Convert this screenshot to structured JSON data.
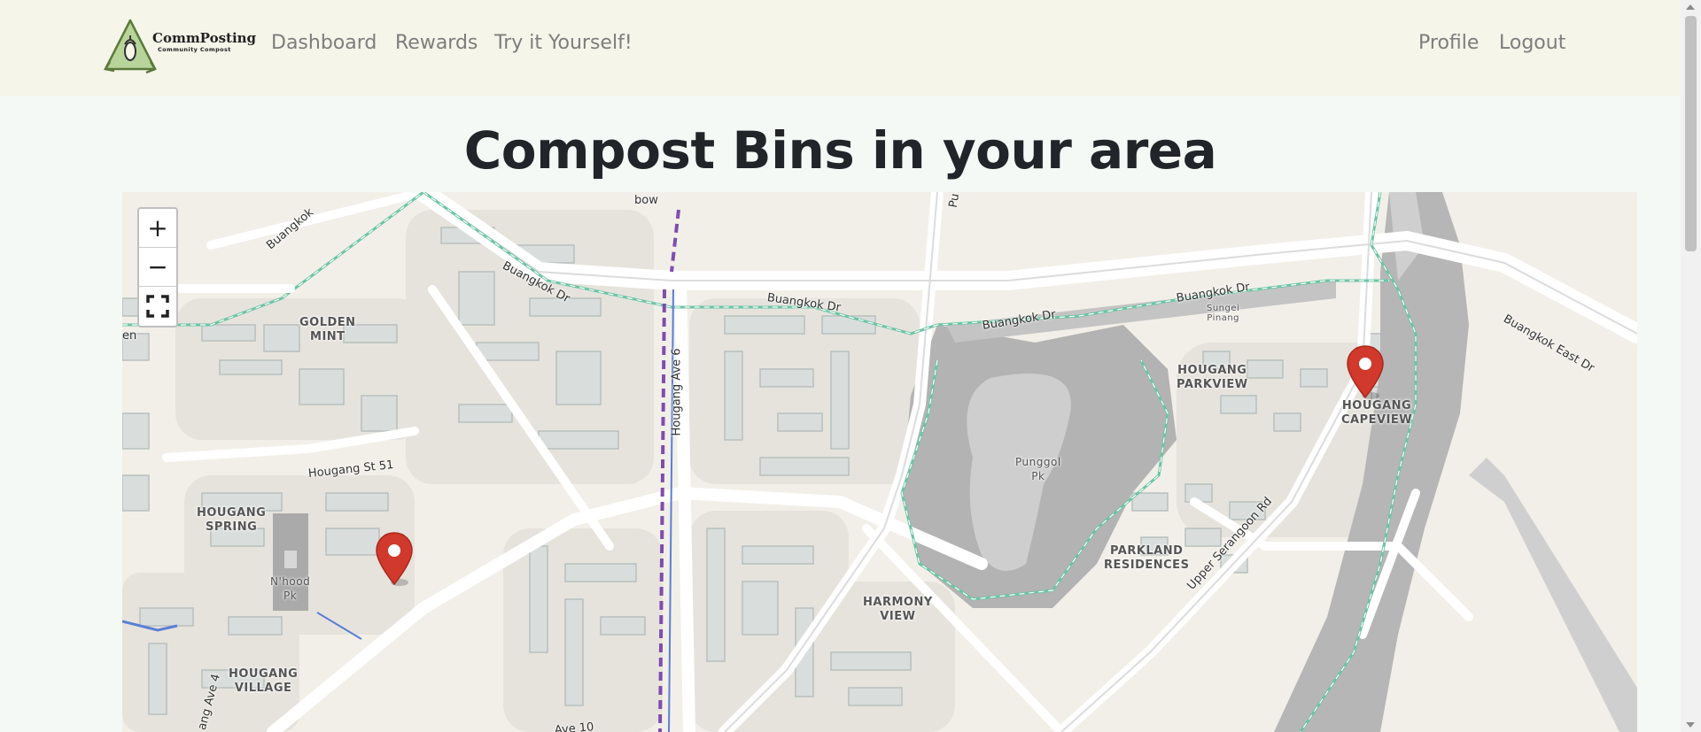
{
  "header": {
    "brand": "CommPosting",
    "brand_sub": "Community Compost",
    "nav": {
      "dashboard": "Dashboard",
      "rewards": "Rewards",
      "try": "Try it Yourself!",
      "profile": "Profile",
      "logout": "Logout"
    }
  },
  "page": {
    "title": "Compost Bins in your area"
  },
  "map": {
    "controls": {
      "zoom_in": "+",
      "zoom_out": "−"
    },
    "labels": {
      "golden_mint": "GOLDEN\nMINT",
      "hougang_spring": "HOUGANG\nSPRING",
      "nhood_pk": "N'hood\nPk",
      "hougang_village": "HOUGANG\nVILLAGE",
      "harmony_view": "HARMONY\nVIEW",
      "punggol_pk": "Punggol\nPk",
      "parkland_residences": "PARKLAND\nRESIDENCES",
      "hougang_parkview": "HOUGANG\nPARKVIEW",
      "hougang_capeview": "HOUGANG\nCAPEVIEW",
      "sungei_pinang": "Sungei\nPinang"
    },
    "roads": {
      "buangkok_dr_1": "Buangkok Dr",
      "buangkok_dr_2": "Buangkok Dr",
      "buangkok_dr_3": "Buangkok Dr",
      "buangkok_dr_4": "Buangkok Dr",
      "buangkok_east_dr": "Buangkok East Dr",
      "buangkok": "Buangkok",
      "hougang_ave_6": "Hougang Ave 6",
      "hougang_st_51": "Hougang St 51",
      "upper_serangoon_rd": "Upper Serangoon Rd",
      "ave_10": "Ave 10",
      "ave_4": "ang Ave 4",
      "bow": "bow",
      "en": "en",
      "pu": "Pu"
    },
    "marker_color": "#d0392b"
  }
}
